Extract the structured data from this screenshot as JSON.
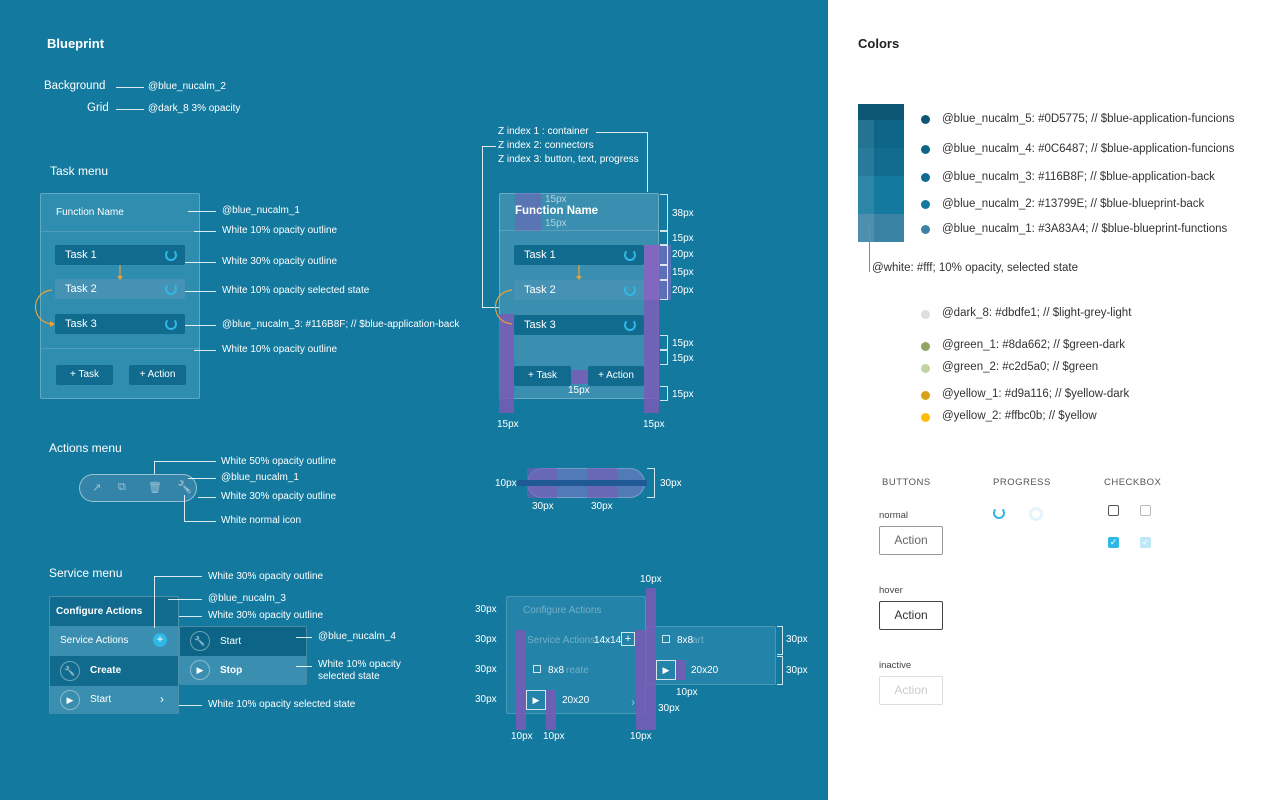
{
  "blueprint": {
    "title": "Blueprint",
    "background_label": "Background",
    "background_value": "@blue_nucalm_2",
    "grid_label": "Grid",
    "grid_value": "@dark_8   3% opacity",
    "task_menu_title": "Task menu",
    "function_name": "Function Name",
    "tasks": [
      "Task 1",
      "Task 2",
      "Task 3"
    ],
    "add_task": "+ Task",
    "add_action": "+ Action",
    "task_annotations": [
      "@blue_nucalm_1",
      "White 10% opacity outline",
      "White 30% opacity outline",
      "White 10% opacity selected state",
      "@blue_nucalm_3: #116B8F; // $blue-application-back",
      "White 10% opacity outline"
    ],
    "zindex": [
      "Z index 1 : container",
      "Z index 2: connectors",
      "Z index 3: button, text, progress"
    ],
    "spec_px": {
      "p15": "15px",
      "p38": "38px",
      "p20": "20px",
      "p30": "30px",
      "p10": "10px",
      "s14": "14x14",
      "s8": "8x8",
      "s20": "20x20"
    },
    "actions_menu_title": "Actions menu",
    "actions_annotations": [
      "White 50% opacity outline",
      "@blue_nucalm_1",
      "White 30% opacity outline",
      "White normal icon"
    ],
    "service_menu_title": "Service menu",
    "configure_actions": "Configure Actions",
    "service_actions": "Service Actions",
    "create": "Create",
    "start": "Start",
    "stop": "Stop",
    "art": "art",
    "reate": "reate",
    "service_annotations": [
      "White 30% opacity outline",
      "@blue_nucalm_3",
      "White 30% opacity outline",
      "@blue_nucalm_4",
      "White 10% opacity",
      "selected state",
      "White 10% opacity selected state"
    ]
  },
  "colors": {
    "title": "Colors",
    "palette": [
      {
        "label": "@blue_nucalm_5: #0D5775; // $blue-application-funcions",
        "hex": "#0D5775"
      },
      {
        "label": "@blue_nucalm_4: #0C6487; // $blue-application-funcions",
        "hex": "#0C6487"
      },
      {
        "label": "@blue_nucalm_3: #116B8F; // $blue-application-back",
        "hex": "#116B8F"
      },
      {
        "label": "@blue_nucalm_2: #13799E; // $blue-blueprint-back",
        "hex": "#13799E"
      },
      {
        "label": "@blue_nucalm_1: #3A83A4; // $blue-blueprint-functions",
        "hex": "#3A83A4"
      }
    ],
    "white_note": "@white: #fff; 10% opacity, selected state",
    "others": [
      {
        "label": "@dark_8:  #dbdfe1; // $light-grey-light",
        "hex": "#dbdfe1"
      },
      {
        "label": "@green_1: #8da662; // $green-dark",
        "hex": "#8da662"
      },
      {
        "label": "@green_2: #c2d5a0; // $green",
        "hex": "#c2d5a0"
      },
      {
        "label": "@yellow_1: #d9a116; // $yellow-dark",
        "hex": "#d9a116"
      },
      {
        "label": "@yellow_2: #ffbc0b; // $yellow",
        "hex": "#ffbc0b"
      }
    ],
    "sections": {
      "buttons": "BUTTONS",
      "progress": "PROGRESS",
      "checkbox": "CHECKBOX"
    },
    "states": {
      "normal": "normal",
      "hover": "hover",
      "inactive": "inactive"
    },
    "action_label": "Action"
  }
}
